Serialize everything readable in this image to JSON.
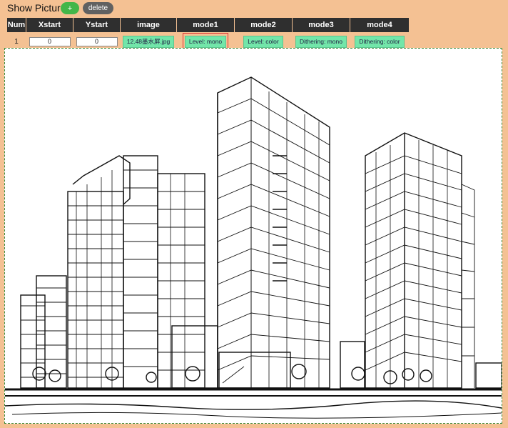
{
  "header": {
    "title": "Show Picture",
    "add_label": "+",
    "delete_label": "delete"
  },
  "table": {
    "columns": [
      "Num",
      "Xstart",
      "Ystart",
      "image",
      "mode1",
      "mode2",
      "mode3",
      "mode4"
    ],
    "rows": [
      {
        "num": "1",
        "xstart": "0",
        "ystart": "0",
        "image": "12.48墨水屏.jpg",
        "mode1": "Level: mono",
        "mode2": "Level: color",
        "mode3": "Dithering: mono",
        "mode4": "Dithering: color"
      }
    ]
  },
  "colors": {
    "background": "#f4c193",
    "header_bg": "#2f2f2f",
    "add": "#43b649",
    "chip": "#72e6a9",
    "selected_border": "#dd3333"
  },
  "preview": {
    "subject": "city skyline line sketch"
  }
}
